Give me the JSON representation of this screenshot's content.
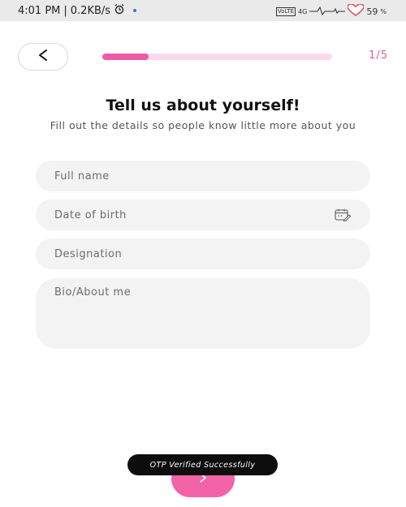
{
  "status_bar": {
    "time": "4:01 PM",
    "separator": "|",
    "speed": "0.2KB/s",
    "network_badge": "VoLTE",
    "network_type": "4G",
    "battery": "59",
    "icons": [
      "alarm-icon",
      "signal-icon",
      "heart-rate-icon",
      "heart-icon"
    ]
  },
  "header": {
    "back_label": "<",
    "progress": 0.2,
    "step_label": "1/5"
  },
  "main": {
    "title": "Tell us about yourself!",
    "subtitle": "Fill out the details so people know little more about you"
  },
  "form": {
    "full_name": {
      "placeholder": "Full name",
      "value": ""
    },
    "date_of_birth": {
      "placeholder": "Date of birth",
      "value": "",
      "icon": "calendar-edit-icon"
    },
    "designation": {
      "placeholder": "Designation",
      "value": ""
    },
    "bio": {
      "placeholder": "Bio/About me",
      "value": ""
    }
  },
  "footer": {
    "next_label": ">",
    "toast": "OTP Verified Successfully"
  },
  "colors": {
    "accent": "#ef5aa7",
    "progress_track": "#fbd9ea",
    "field_bg": "#f3f3f3",
    "toast_bg": "#0d0d0d"
  }
}
